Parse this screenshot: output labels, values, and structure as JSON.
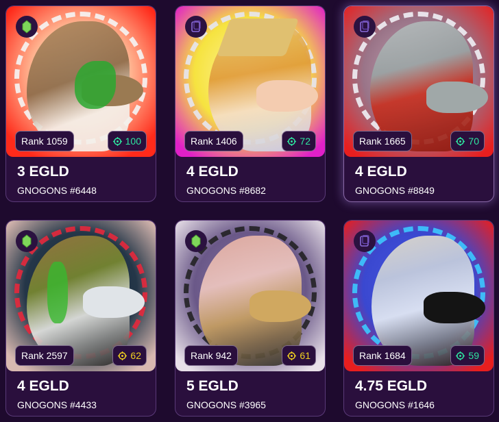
{
  "colors": {
    "page_background": "#1e0a2e",
    "card_background": "#2a0f3d",
    "green_score": "#2ee6a0",
    "yellow_score": "#f0d020"
  },
  "cards": [
    {
      "price": "3 EGLD",
      "name": "GNOGONS #6448",
      "rank": "Rank 1059",
      "score": "100",
      "badge_icon": "gem-icon",
      "score_color": "#2ee6a0"
    },
    {
      "price": "4 EGLD",
      "name": "GNOGONS #8682",
      "rank": "Rank 1406",
      "score": "72",
      "badge_icon": "card-stack-icon",
      "score_color": "#2ee6a0"
    },
    {
      "price": "4 EGLD",
      "name": "GNOGONS #8849",
      "rank": "Rank 1665",
      "score": "70",
      "badge_icon": "card-stack-icon",
      "score_color": "#2ee6a0"
    },
    {
      "price": "4 EGLD",
      "name": "GNOGONS #4433",
      "rank": "Rank 2597",
      "score": "62",
      "badge_icon": "gem-icon",
      "score_color": "#f0d020"
    },
    {
      "price": "5 EGLD",
      "name": "GNOGONS #3965",
      "rank": "Rank 942",
      "score": "61",
      "badge_icon": "gem-icon",
      "score_color": "#f0d020"
    },
    {
      "price": "4.75 EGLD",
      "name": "GNOGONS #1646",
      "rank": "Rank 1684",
      "score": "59",
      "badge_icon": "card-stack-icon",
      "score_color": "#2ee6a0"
    }
  ]
}
